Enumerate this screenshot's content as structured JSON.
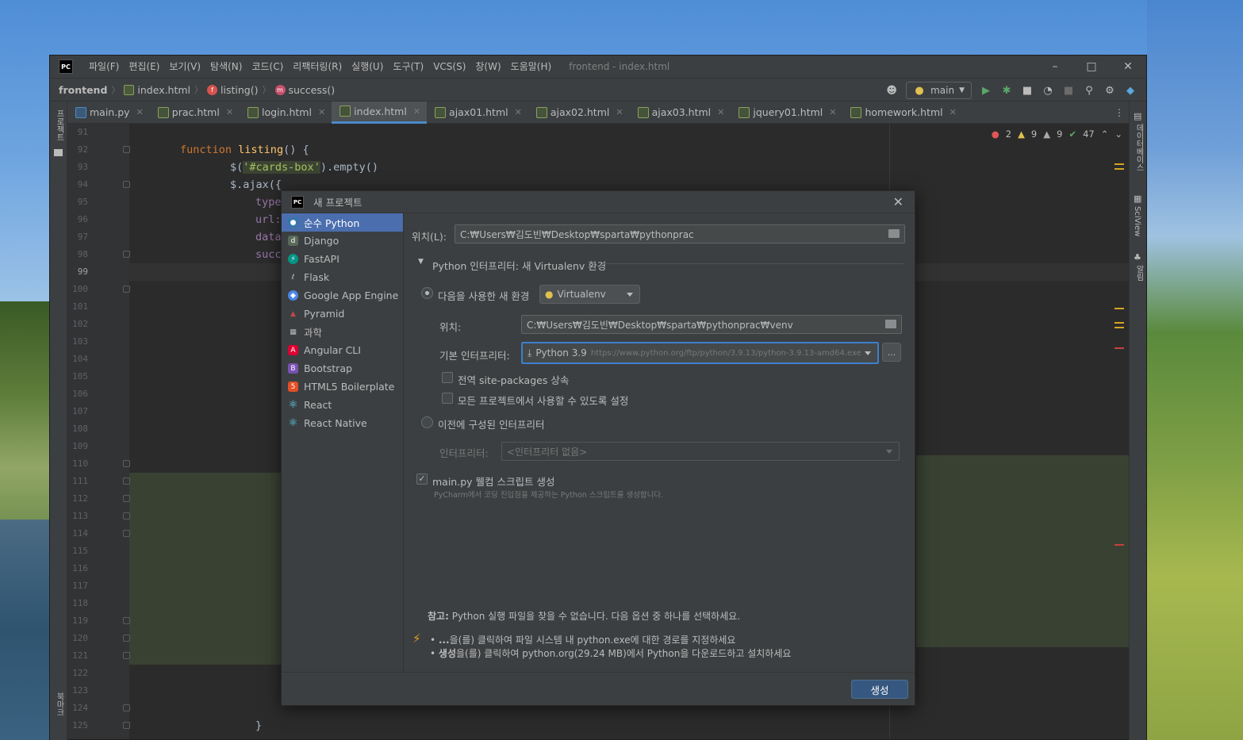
{
  "window": {
    "title": "frontend - index.html",
    "menu": [
      "파일(F)",
      "편집(E)",
      "보기(V)",
      "탐색(N)",
      "코드(C)",
      "리팩터링(R)",
      "실행(U)",
      "도구(T)",
      "VCS(S)",
      "창(W)",
      "도움말(H)"
    ],
    "app_logo": "PC"
  },
  "breadcrumb": {
    "project": "frontend",
    "file": "index.html",
    "function": "listing()",
    "method": "success()"
  },
  "toolbar": {
    "branch": "main"
  },
  "tabs": [
    {
      "label": "main.py",
      "icon": "python-file-icon"
    },
    {
      "label": "prac.html",
      "icon": "html-file-icon"
    },
    {
      "label": "login.html",
      "icon": "html-file-icon"
    },
    {
      "label": "index.html",
      "icon": "html-file-icon",
      "active": true
    },
    {
      "label": "ajax01.html",
      "icon": "html-file-icon"
    },
    {
      "label": "ajax02.html",
      "icon": "html-file-icon"
    },
    {
      "label": "ajax03.html",
      "icon": "html-file-icon"
    },
    {
      "label": "jquery01.html",
      "icon": "html-file-icon"
    },
    {
      "label": "homework.html",
      "icon": "html-file-icon"
    }
  ],
  "left_strip": {
    "project_label": "프로젝트",
    "bookmarks_label": "북마크"
  },
  "right_strip": {
    "database_label": "데이터베이스",
    "sciview_label": "SciView",
    "notifications_label": "알림"
  },
  "inspections": {
    "errors": "2",
    "warnings": "9",
    "weak_warnings": "9",
    "ok": "47"
  },
  "editor": {
    "line_numbers": [
      "91",
      "92",
      "93",
      "94",
      "95",
      "96",
      "97",
      "98",
      "99",
      "100",
      "101",
      "102",
      "103",
      "104",
      "105",
      "106",
      "107",
      "108",
      "109",
      "110",
      "111",
      "112",
      "113",
      "114",
      "115",
      "116",
      "117",
      "118",
      "119",
      "120",
      "121",
      "122",
      "123",
      "124",
      "125"
    ],
    "code": {
      "l92_kw": "function",
      "l92_fn": "listing",
      "l92_rest": "() {",
      "l93_pre": "$(",
      "l93_sel": "'#cards-box'",
      "l93_post": ").empty()",
      "l94": "$.ajax({",
      "l95": "type",
      "l96": "url:",
      "l97": "data",
      "l98": "succ",
      "l125": "}"
    }
  },
  "dialog": {
    "title": "새 프로젝트",
    "sidebar": [
      {
        "label": "순수 Python",
        "icon": "python-icon",
        "color": "#3776ab"
      },
      {
        "label": "Django",
        "icon": "django-icon",
        "color": "#5a7a5a"
      },
      {
        "label": "FastAPI",
        "icon": "fastapi-icon",
        "color": "#059487"
      },
      {
        "label": "Flask",
        "icon": "flask-icon",
        "color": "#777777"
      },
      {
        "label": "Google App Engine",
        "icon": "google-app-engine-icon",
        "color": "#4a86e8"
      },
      {
        "label": "Pyramid",
        "icon": "pyramid-icon",
        "color": "#a94442"
      },
      {
        "label": "과학",
        "icon": "science-icon",
        "color": "#888888"
      },
      {
        "label": "Angular CLI",
        "icon": "angular-icon",
        "color": "#dd0031"
      },
      {
        "label": "Bootstrap",
        "icon": "bootstrap-icon",
        "color": "#7952b3"
      },
      {
        "label": "HTML5 Boilerplate",
        "icon": "html5-icon",
        "color": "#e34f26"
      },
      {
        "label": "React",
        "icon": "react-icon",
        "color": "#61dafb"
      },
      {
        "label": "React Native",
        "icon": "react-native-icon",
        "color": "#61dafb"
      }
    ],
    "location_label": "위치(L):",
    "location_value": "C:₩Users₩김도빈₩Desktop₩sparta₩pythonprac",
    "interpreter_section": "Python 인터프리터: 새 Virtualenv 환경",
    "new_env_label": "다음을 사용한 새 환경",
    "env_type": "Virtualenv",
    "env_location_label": "위치:",
    "env_location_value": "C:₩Users₩김도빈₩Desktop₩sparta₩pythonprac₩venv",
    "base_interpreter_label": "기본 인터프리터:",
    "base_interpreter_name": "Python 3.9",
    "base_interpreter_url": "https://www.python.org/ftp/python/3.9.13/python-3.9.13-amd64.exe",
    "browse_btn": "...",
    "inherit_label": "전역 site-packages 상속",
    "all_projects_label": "모든 프로젝트에서 사용할 수 있도록 설정",
    "existing_label": "이전에 구성된 인터프리터",
    "interpreter_label": "인터프리터:",
    "interpreter_value": "<인터프리터 없음>",
    "welcome_label": "main.py 웰컴 스크립트 생성",
    "welcome_hint": "PyCharm에서 코딩 진입점을 제공하는 Python 스크립트를 생성합니다.",
    "note_title": "참고:",
    "note_text": "Python 실행 파일을 찾을 수 없습니다. 다음 옵션 중 하나를 선택하세요.",
    "bullet1_prefix": "...",
    "bullet1_text": "을(를) 클릭하여 파일 시스템 내 python.exe에 대한 경로를 지정하세요",
    "bullet2_prefix": "생성",
    "bullet2_text": "을(를) 클릭하여 python.org(29.24 MB)에서 Python을 다운로드하고 설치하세요",
    "create_btn": "생성"
  }
}
